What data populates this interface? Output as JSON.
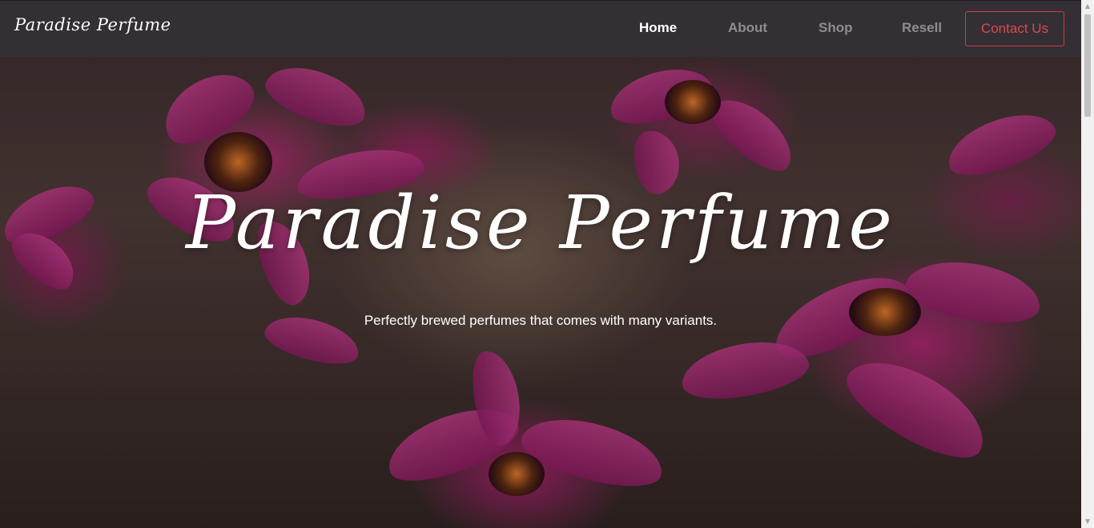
{
  "brand": {
    "name": "Paradise Perfume"
  },
  "nav": {
    "items": [
      {
        "label": "Home",
        "active": true
      },
      {
        "label": "About",
        "active": false
      },
      {
        "label": "Shop",
        "active": false
      },
      {
        "label": "Resell",
        "active": false
      }
    ],
    "contact_label": "Contact Us"
  },
  "hero": {
    "title": "Paradise Perfume",
    "subtitle": "Perfectly brewed perfumes that comes with many variants."
  },
  "colors": {
    "navbar_bg": "#343036",
    "active_link": "#ffffff",
    "inactive_link": "#8e8e8e",
    "contact_accent": "#e0474f",
    "flower_magenta": "#b02a7a"
  },
  "icons": {
    "scroll_up": "triangle-up",
    "scroll_down": "triangle-down"
  }
}
